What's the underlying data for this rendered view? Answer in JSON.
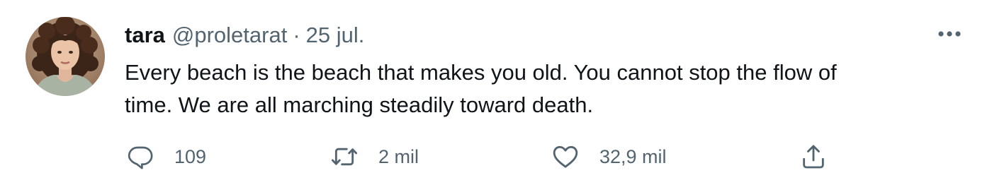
{
  "tweet": {
    "display_name": "tara",
    "handle": "@proletarat",
    "separator": "·",
    "date": "25 jul.",
    "lines": [
      "Every beach is the beach that makes you old. You cannot stop the flow of",
      "time. We are all marching steadily toward death."
    ],
    "more_icon": "more-horizontal-icon",
    "avatar": "profile-photo"
  },
  "actions": {
    "reply": {
      "icon": "reply-bubble-icon",
      "count": "109"
    },
    "retweet": {
      "icon": "retweet-icon",
      "count": "2 mil"
    },
    "like": {
      "icon": "heart-icon",
      "count": "32,9 mil"
    },
    "share": {
      "icon": "share-upload-icon"
    }
  },
  "colors": {
    "text_primary": "#0f1419",
    "text_secondary": "#536471",
    "icon": "#536471",
    "background": "#ffffff"
  }
}
